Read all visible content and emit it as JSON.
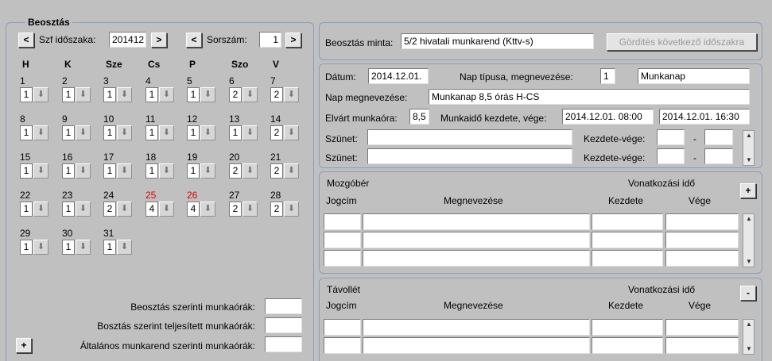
{
  "beosztas": {
    "legend": "Beosztás",
    "szf_label": "Szf időszaka:",
    "szf_value": "201412",
    "sorszam_label": "Sorszám:",
    "sorszam_value": "1",
    "prev": "<",
    "next": ">",
    "weekdays": [
      "H",
      "K",
      "Sze",
      "Cs",
      "P",
      "Szo",
      "V"
    ],
    "days": [
      {
        "n": "1",
        "v": "1",
        "red": false
      },
      {
        "n": "2",
        "v": "1",
        "red": false
      },
      {
        "n": "3",
        "v": "1",
        "red": false
      },
      {
        "n": "4",
        "v": "1",
        "red": false
      },
      {
        "n": "5",
        "v": "1",
        "red": false
      },
      {
        "n": "6",
        "v": "2",
        "red": false
      },
      {
        "n": "7",
        "v": "2",
        "red": false
      },
      {
        "n": "8",
        "v": "1",
        "red": false
      },
      {
        "n": "9",
        "v": "1",
        "red": false
      },
      {
        "n": "10",
        "v": "1",
        "red": false
      },
      {
        "n": "11",
        "v": "1",
        "red": false
      },
      {
        "n": "12",
        "v": "1",
        "red": false
      },
      {
        "n": "13",
        "v": "1",
        "red": false
      },
      {
        "n": "14",
        "v": "2",
        "red": false
      },
      {
        "n": "15",
        "v": "1",
        "red": false
      },
      {
        "n": "16",
        "v": "1",
        "red": false
      },
      {
        "n": "17",
        "v": "1",
        "red": false
      },
      {
        "n": "18",
        "v": "1",
        "red": false
      },
      {
        "n": "19",
        "v": "1",
        "red": false
      },
      {
        "n": "20",
        "v": "2",
        "red": false
      },
      {
        "n": "21",
        "v": "2",
        "red": false
      },
      {
        "n": "22",
        "v": "1",
        "red": false
      },
      {
        "n": "23",
        "v": "1",
        "red": false
      },
      {
        "n": "24",
        "v": "2",
        "red": false
      },
      {
        "n": "25",
        "v": "4",
        "red": true
      },
      {
        "n": "26",
        "v": "4",
        "red": true
      },
      {
        "n": "27",
        "v": "2",
        "red": false
      },
      {
        "n": "28",
        "v": "2",
        "red": false
      },
      {
        "n": "29",
        "v": "1",
        "red": false
      },
      {
        "n": "30",
        "v": "1",
        "red": false
      },
      {
        "n": "31",
        "v": "1",
        "red": false
      }
    ],
    "arrow_icon": "down-arrow-icon",
    "sum1_label": "Beosztás szerinti munkaórák:",
    "sum2_label": "Bosztás szerint teljesített munkaórák:",
    "sum3_label": "Általános munkarend szerinti munkaórák:",
    "plus": "+"
  },
  "minta": {
    "label": "Beosztás minta:",
    "value": "5/2  hivatali munkarend (Kttv-s)",
    "button": "Görditės következő időszakra"
  },
  "nap": {
    "datum_label": "Dátum:",
    "datum_value": "2014.12.01.",
    "tipus_label": "Nap típusa, megnevezése:",
    "tipus_code": "1",
    "tipus_name": "Munkanap",
    "megnev_label": "Nap megnevezése:",
    "megnev_value": "Munkanap 8,5 órás H-CS",
    "elvart_label": "Elvárt munkaóra:",
    "elvart_value": "8,5",
    "kezd_label": "Munkaidő kezdete, vége:",
    "kezd_value": "2014.12.01. 08:00",
    "vege_value": "2014.12.01. 16:30",
    "szunet_label": "Szünet:",
    "kv_label": "Kezdete-vége:",
    "dash": "-"
  },
  "mozgober": {
    "title": "Mozgóbér",
    "vonat": "Vonatkozási idő",
    "jogcim": "Jogcím",
    "megnev": "Megnevezése",
    "kezdete": "Kezdete",
    "vege": "Vége",
    "btn": "+"
  },
  "tavollet": {
    "title": "Távollét",
    "vonat": "Vonatkozási idő",
    "jogcim": "Jogcím",
    "megnev": "Megnevezése",
    "kezdete": "Kezdete",
    "vege": "Vége",
    "btn": "-"
  }
}
